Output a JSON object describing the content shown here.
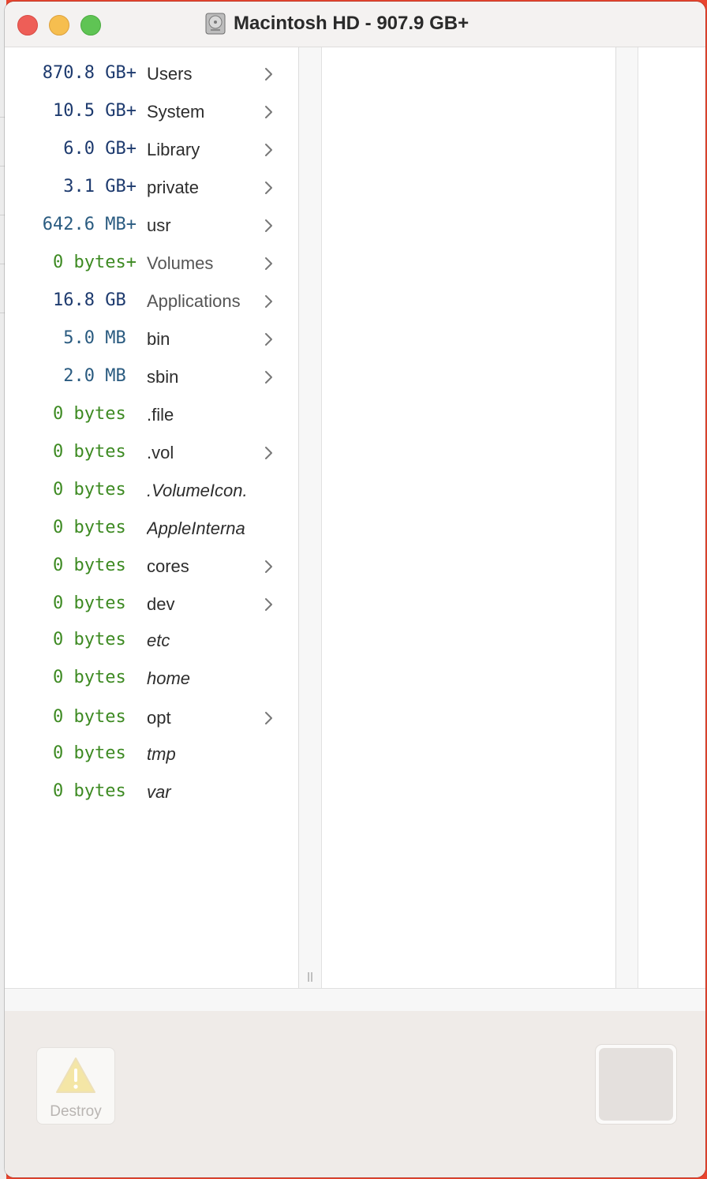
{
  "window": {
    "title": "Macintosh HD - 907.9 GB+",
    "disk_icon": "hard-drive-icon",
    "controls": [
      "close",
      "minimize",
      "zoom"
    ]
  },
  "colors": {
    "size_dark_blue": "#1d3a6e",
    "size_blue": "#2a5b80",
    "size_green": "#3d8a22",
    "name_text": "#2d2d2d",
    "chevron": "#777777"
  },
  "items": [
    {
      "size": "870.8 GB+",
      "name": "Users",
      "italic": false,
      "has_children": true,
      "size_color": "#1d3a6e"
    },
    {
      "size": "10.5 GB+",
      "name": "System",
      "italic": false,
      "has_children": true,
      "size_color": "#1d3a6e"
    },
    {
      "size": "6.0 GB+",
      "name": "Library",
      "italic": false,
      "has_children": true,
      "size_color": "#1d3a6e"
    },
    {
      "size": "3.1 GB+",
      "name": "private",
      "italic": false,
      "has_children": true,
      "size_color": "#1d3a6e"
    },
    {
      "size": "642.6 MB+",
      "name": "usr",
      "italic": false,
      "has_children": true,
      "size_color": "#2a5b80"
    },
    {
      "size": "0 bytes+",
      "name": "Volumes",
      "italic": false,
      "has_children": true,
      "size_color": "#3d8a22",
      "dim": true
    },
    {
      "size": "16.8 GB ",
      "name": "Applications",
      "italic": false,
      "has_children": true,
      "size_color": "#1d3a6e",
      "dim": true
    },
    {
      "size": "5.0 MB ",
      "name": "bin",
      "italic": false,
      "has_children": true,
      "size_color": "#2a5b80"
    },
    {
      "size": "2.0 MB ",
      "name": "sbin",
      "italic": false,
      "has_children": true,
      "size_color": "#2a5b80"
    },
    {
      "size": "0 bytes ",
      "name": ".file",
      "italic": false,
      "has_children": false,
      "size_color": "#3d8a22"
    },
    {
      "size": "0 bytes ",
      "name": ".vol",
      "italic": false,
      "has_children": true,
      "size_color": "#3d8a22"
    },
    {
      "size": "0 bytes ",
      "name": ".VolumeIcon.",
      "italic": true,
      "has_children": false,
      "size_color": "#3d8a22"
    },
    {
      "size": "0 bytes ",
      "name": "AppleInterna",
      "italic": true,
      "has_children": false,
      "size_color": "#3d8a22"
    },
    {
      "size": "0 bytes ",
      "name": "cores",
      "italic": false,
      "has_children": true,
      "size_color": "#3d8a22"
    },
    {
      "size": "0 bytes ",
      "name": "dev",
      "italic": false,
      "has_children": true,
      "size_color": "#3d8a22"
    },
    {
      "size": "0 bytes ",
      "name": "etc",
      "italic": true,
      "has_children": false,
      "size_color": "#3d8a22"
    },
    {
      "size": "0 bytes ",
      "name": "home",
      "italic": true,
      "has_children": false,
      "size_color": "#3d8a22"
    },
    {
      "size": "0 bytes ",
      "name": "opt",
      "italic": false,
      "has_children": true,
      "size_color": "#3d8a22"
    },
    {
      "size": "0 bytes ",
      "name": "tmp",
      "italic": true,
      "has_children": false,
      "size_color": "#3d8a22"
    },
    {
      "size": "0 bytes ",
      "name": "var",
      "italic": true,
      "has_children": false,
      "size_color": "#3d8a22"
    }
  ],
  "footer": {
    "destroy_label": "Destroy",
    "destroy_icon": "warning-icon",
    "preview": "preview-well"
  }
}
